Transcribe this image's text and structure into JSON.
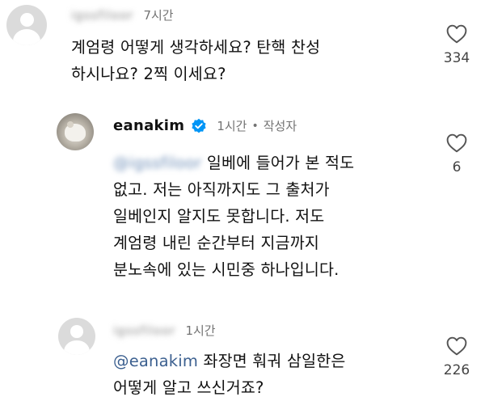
{
  "comments": [
    {
      "username": "igssfiloor",
      "time": "7시간",
      "text_line1": "계엄령 어떻게 생각하세요? 탄핵 찬성",
      "text_line2": "하시나요? 2찍 이세요?",
      "likes": "334"
    },
    {
      "username": "eanakim",
      "time": "1시간",
      "dot": "•",
      "author_tag": "작성자",
      "mention": "@igssfiloor",
      "text_line1": "일베에 들어가 본 적도",
      "text_line2": "없고. 저는 아직까지도 그 출처가",
      "text_line3": "일베인지 알지도 못합니다. 저도",
      "text_line4": "계엄령 내린 순간부터 지금까지",
      "text_line5": "분노속에 있는 시민중 하나입니다.",
      "likes": "6"
    },
    {
      "username": "igssfiloor",
      "time": "1시간",
      "mention": "@eanakim",
      "text_line1": " 좌장면 훠궈 삼일한은",
      "text_line2": "어떻게 알고 쓰신거죠?",
      "likes": "226"
    }
  ],
  "icons": {
    "like": "heart-icon",
    "verified": "verified-badge-icon"
  },
  "colors": {
    "mention": "#3b5f8f",
    "verified": "#0095f6",
    "meta": "#737373"
  }
}
